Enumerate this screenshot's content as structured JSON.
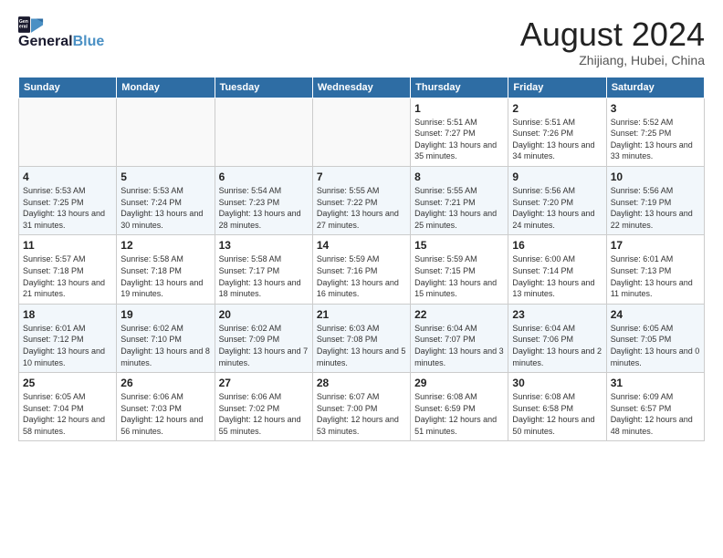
{
  "header": {
    "logo_line1": "General",
    "logo_line1_blue": "Blue",
    "month_title": "August 2024",
    "location": "Zhijiang, Hubei, China"
  },
  "days_of_week": [
    "Sunday",
    "Monday",
    "Tuesday",
    "Wednesday",
    "Thursday",
    "Friday",
    "Saturday"
  ],
  "weeks": [
    [
      {
        "day": "",
        "info": ""
      },
      {
        "day": "",
        "info": ""
      },
      {
        "day": "",
        "info": ""
      },
      {
        "day": "",
        "info": ""
      },
      {
        "day": "1",
        "info": "Sunrise: 5:51 AM\nSunset: 7:27 PM\nDaylight: 13 hours\nand 35 minutes."
      },
      {
        "day": "2",
        "info": "Sunrise: 5:51 AM\nSunset: 7:26 PM\nDaylight: 13 hours\nand 34 minutes."
      },
      {
        "day": "3",
        "info": "Sunrise: 5:52 AM\nSunset: 7:25 PM\nDaylight: 13 hours\nand 33 minutes."
      }
    ],
    [
      {
        "day": "4",
        "info": "Sunrise: 5:53 AM\nSunset: 7:25 PM\nDaylight: 13 hours\nand 31 minutes."
      },
      {
        "day": "5",
        "info": "Sunrise: 5:53 AM\nSunset: 7:24 PM\nDaylight: 13 hours\nand 30 minutes."
      },
      {
        "day": "6",
        "info": "Sunrise: 5:54 AM\nSunset: 7:23 PM\nDaylight: 13 hours\nand 28 minutes."
      },
      {
        "day": "7",
        "info": "Sunrise: 5:55 AM\nSunset: 7:22 PM\nDaylight: 13 hours\nand 27 minutes."
      },
      {
        "day": "8",
        "info": "Sunrise: 5:55 AM\nSunset: 7:21 PM\nDaylight: 13 hours\nand 25 minutes."
      },
      {
        "day": "9",
        "info": "Sunrise: 5:56 AM\nSunset: 7:20 PM\nDaylight: 13 hours\nand 24 minutes."
      },
      {
        "day": "10",
        "info": "Sunrise: 5:56 AM\nSunset: 7:19 PM\nDaylight: 13 hours\nand 22 minutes."
      }
    ],
    [
      {
        "day": "11",
        "info": "Sunrise: 5:57 AM\nSunset: 7:18 PM\nDaylight: 13 hours\nand 21 minutes."
      },
      {
        "day": "12",
        "info": "Sunrise: 5:58 AM\nSunset: 7:18 PM\nDaylight: 13 hours\nand 19 minutes."
      },
      {
        "day": "13",
        "info": "Sunrise: 5:58 AM\nSunset: 7:17 PM\nDaylight: 13 hours\nand 18 minutes."
      },
      {
        "day": "14",
        "info": "Sunrise: 5:59 AM\nSunset: 7:16 PM\nDaylight: 13 hours\nand 16 minutes."
      },
      {
        "day": "15",
        "info": "Sunrise: 5:59 AM\nSunset: 7:15 PM\nDaylight: 13 hours\nand 15 minutes."
      },
      {
        "day": "16",
        "info": "Sunrise: 6:00 AM\nSunset: 7:14 PM\nDaylight: 13 hours\nand 13 minutes."
      },
      {
        "day": "17",
        "info": "Sunrise: 6:01 AM\nSunset: 7:13 PM\nDaylight: 13 hours\nand 11 minutes."
      }
    ],
    [
      {
        "day": "18",
        "info": "Sunrise: 6:01 AM\nSunset: 7:12 PM\nDaylight: 13 hours\nand 10 minutes."
      },
      {
        "day": "19",
        "info": "Sunrise: 6:02 AM\nSunset: 7:10 PM\nDaylight: 13 hours\nand 8 minutes."
      },
      {
        "day": "20",
        "info": "Sunrise: 6:02 AM\nSunset: 7:09 PM\nDaylight: 13 hours\nand 7 minutes."
      },
      {
        "day": "21",
        "info": "Sunrise: 6:03 AM\nSunset: 7:08 PM\nDaylight: 13 hours\nand 5 minutes."
      },
      {
        "day": "22",
        "info": "Sunrise: 6:04 AM\nSunset: 7:07 PM\nDaylight: 13 hours\nand 3 minutes."
      },
      {
        "day": "23",
        "info": "Sunrise: 6:04 AM\nSunset: 7:06 PM\nDaylight: 13 hours\nand 2 minutes."
      },
      {
        "day": "24",
        "info": "Sunrise: 6:05 AM\nSunset: 7:05 PM\nDaylight: 13 hours\nand 0 minutes."
      }
    ],
    [
      {
        "day": "25",
        "info": "Sunrise: 6:05 AM\nSunset: 7:04 PM\nDaylight: 12 hours\nand 58 minutes."
      },
      {
        "day": "26",
        "info": "Sunrise: 6:06 AM\nSunset: 7:03 PM\nDaylight: 12 hours\nand 56 minutes."
      },
      {
        "day": "27",
        "info": "Sunrise: 6:06 AM\nSunset: 7:02 PM\nDaylight: 12 hours\nand 55 minutes."
      },
      {
        "day": "28",
        "info": "Sunrise: 6:07 AM\nSunset: 7:00 PM\nDaylight: 12 hours\nand 53 minutes."
      },
      {
        "day": "29",
        "info": "Sunrise: 6:08 AM\nSunset: 6:59 PM\nDaylight: 12 hours\nand 51 minutes."
      },
      {
        "day": "30",
        "info": "Sunrise: 6:08 AM\nSunset: 6:58 PM\nDaylight: 12 hours\nand 50 minutes."
      },
      {
        "day": "31",
        "info": "Sunrise: 6:09 AM\nSunset: 6:57 PM\nDaylight: 12 hours\nand 48 minutes."
      }
    ]
  ]
}
